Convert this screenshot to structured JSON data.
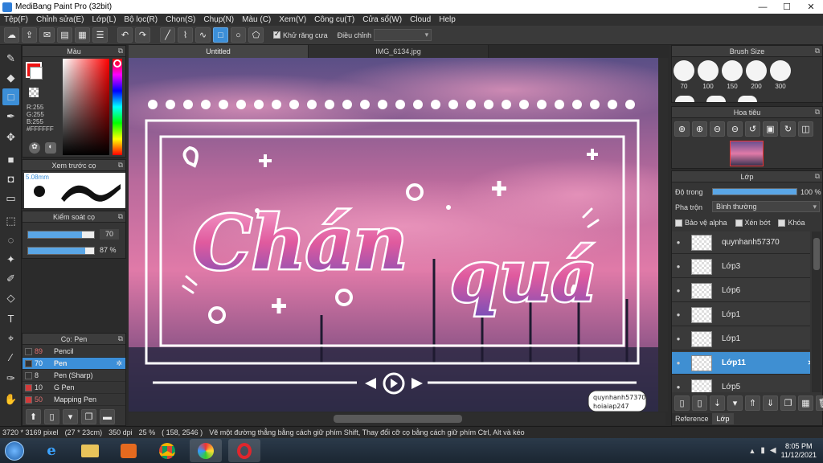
{
  "window": {
    "title": "MediBang Paint Pro (32bit)"
  },
  "menu": [
    "Tệp(F)",
    "Chỉnh sửa(E)",
    "Lớp(L)",
    "Bộ lọc(R)",
    "Chọn(S)",
    "Chụp(N)",
    "Màu (C)",
    "Xem(V)",
    "Công cụ(T)",
    "Cửa sổ(W)",
    "Cloud",
    "Help"
  ],
  "toolbar": {
    "antialias_label": "Khử răng cưa",
    "antialias_checked": true,
    "adjust_label": "Điều chỉnh",
    "adjust_value": ""
  },
  "tabs": [
    {
      "label": "Untitled"
    },
    {
      "label": "IMG_6134.jpg"
    }
  ],
  "color_panel": {
    "title": "Màu",
    "r": "R:255",
    "g": "G:255",
    "b": "B:255",
    "hex": "#FFFFFF"
  },
  "brush_preview": {
    "title": "Xem trước cọ",
    "size": "5.08mm"
  },
  "brush_control": {
    "title": "Kiểm soát cọ",
    "size_value": "70",
    "opacity_value": "87 %"
  },
  "brush_list": {
    "title": "Cọ: Pen",
    "items": [
      {
        "size": "89",
        "name": "Pencil",
        "color": "#333333"
      },
      {
        "size": "70",
        "name": "Pen",
        "color": "#333333",
        "selected": true
      },
      {
        "size": "8",
        "name": "Pen (Sharp)",
        "color": "#333333"
      },
      {
        "size": "10",
        "name": "G Pen",
        "color": "#d23a3a"
      },
      {
        "size": "50",
        "name": "Mapping Pen",
        "color": "#d23a3a"
      }
    ]
  },
  "brush_size_panel": {
    "title": "Brush Size",
    "sizes": [
      "70",
      "100",
      "150",
      "200",
      "300"
    ]
  },
  "navigator": {
    "title": "Hoa tiêu"
  },
  "layer_panel": {
    "title": "Lớp",
    "opacity_label": "Độ trong",
    "opacity_value": "100 %",
    "blend_label": "Pha trộn",
    "blend_value": "Bình thường",
    "protect_alpha": "Bảo vệ alpha",
    "clipping": "Xén bớt",
    "lock": "Khóa",
    "layers": [
      {
        "name": "quynhanh57370"
      },
      {
        "name": "Lớp3"
      },
      {
        "name": "Lớp6"
      },
      {
        "name": "Lớp1"
      },
      {
        "name": "Lớp1"
      },
      {
        "name": "Lớp11",
        "selected": true
      },
      {
        "name": "Lớp5"
      }
    ],
    "bottom_tabs": [
      "Reference",
      "Lớp"
    ]
  },
  "artwork": {
    "headline_line1": "Chán",
    "headline_line2": "quá",
    "credit_line1": "quynhanh57370",
    "credit_line2": "hoiaiap247"
  },
  "status": {
    "dimensions": "3720 * 3169 pixel",
    "physical": "(27 * 23cm)",
    "dpi": "350 dpi",
    "zoom": "25 %",
    "coords": "( 158, 2546 )",
    "hint": "Vẽ một đường thẳng bằng cách giữ phím Shift, Thay đổi cỡ cọ bằng cách giữ phím Ctrl, Alt và kéo"
  },
  "taskbar": {
    "time": "8:05 PM",
    "date": "11/12/2021"
  },
  "colors": {
    "accent": "#3c8fd8",
    "panel_bg": "#353535"
  }
}
